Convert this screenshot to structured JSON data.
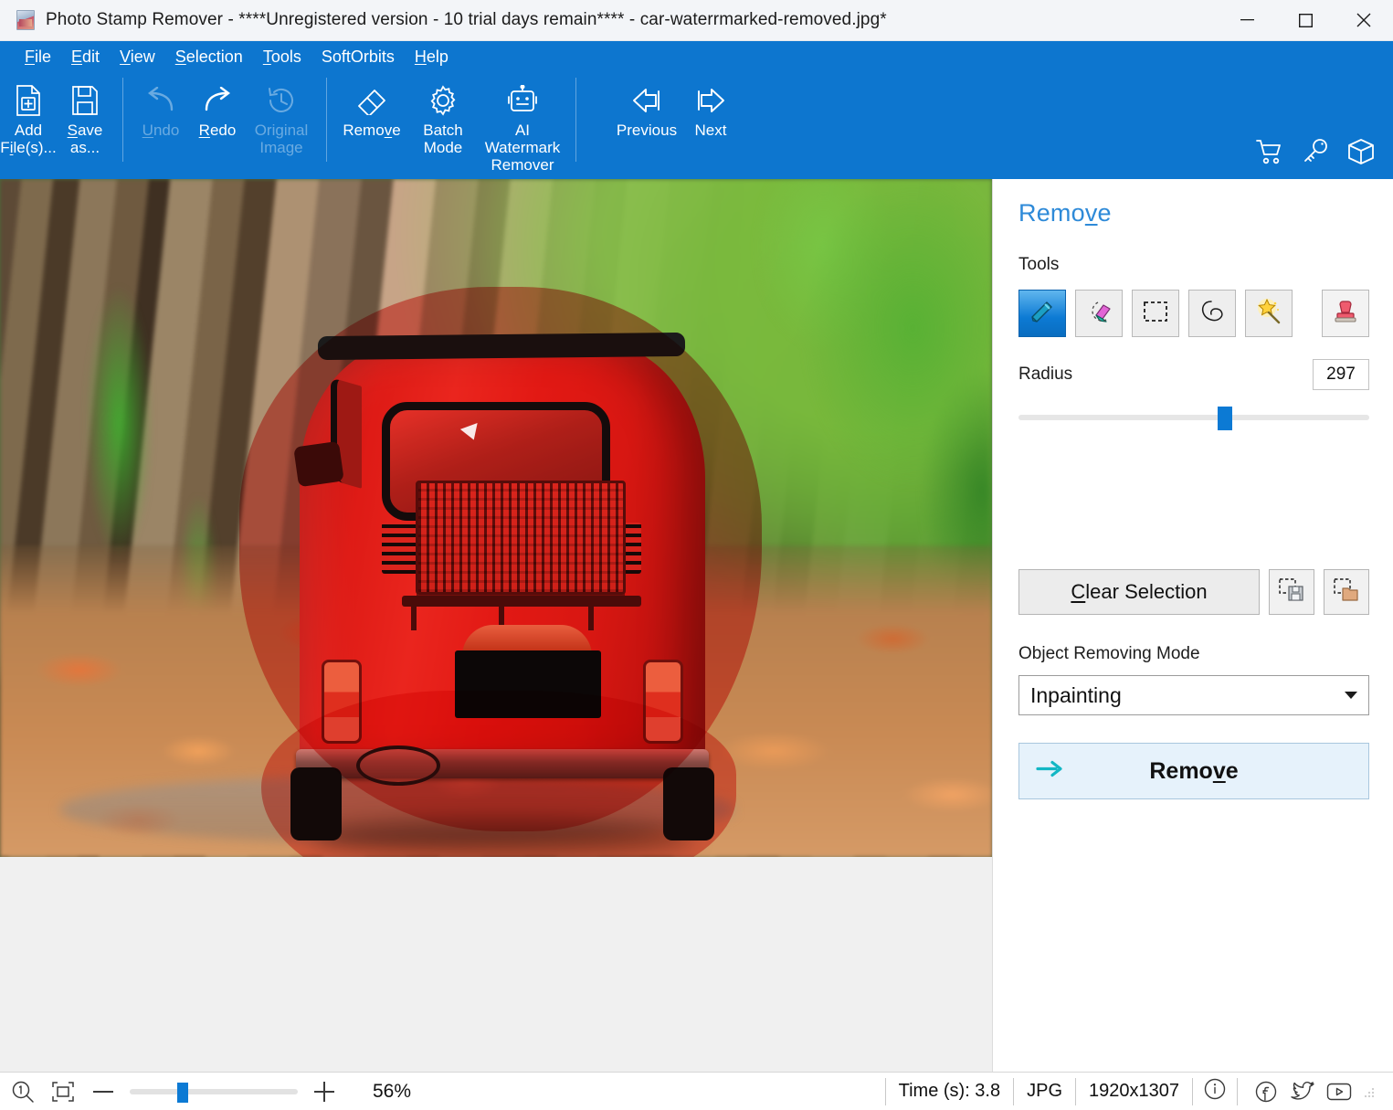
{
  "window": {
    "title": "Photo Stamp Remover - ****Unregistered version - 10 trial days remain**** - car-waterrmarked-removed.jpg*",
    "app_icon": "app-icon",
    "minimize": "minimize-icon",
    "maximize": "maximize-icon",
    "close": "close-icon"
  },
  "menu": {
    "items": [
      {
        "label": "File",
        "accel": "F"
      },
      {
        "label": "Edit",
        "accel": "E"
      },
      {
        "label": "View",
        "accel": "V"
      },
      {
        "label": "Selection",
        "accel": "S"
      },
      {
        "label": "Tools",
        "accel": "T"
      },
      {
        "label": "SoftOrbits",
        "accel": ""
      },
      {
        "label": "Help",
        "accel": "H"
      }
    ]
  },
  "ribbon": {
    "buttons": [
      {
        "name": "add-files",
        "line1": "Add",
        "line2": "File(s)...",
        "icon": "add-file-icon",
        "disabled": false
      },
      {
        "name": "save-as",
        "line1": "Save",
        "line2": "as...",
        "icon": "save-icon",
        "disabled": false
      },
      {
        "name": "undo",
        "line1": "Undo",
        "line2": "",
        "icon": "undo-icon",
        "disabled": true
      },
      {
        "name": "redo",
        "line1": "Redo",
        "line2": "",
        "icon": "redo-icon",
        "disabled": false
      },
      {
        "name": "original",
        "line1": "Original",
        "line2": "Image",
        "icon": "history-icon",
        "disabled": true
      },
      {
        "name": "remove",
        "line1": "Remove",
        "line2": "",
        "icon": "eraser-icon",
        "disabled": false
      },
      {
        "name": "batch-mode",
        "line1": "Batch",
        "line2": "Mode",
        "icon": "gear-icon",
        "disabled": false
      },
      {
        "name": "ai-watermark",
        "line1": "AI Watermark",
        "line2": "Remover",
        "icon": "robot-icon",
        "disabled": false
      },
      {
        "name": "previous",
        "line1": "Previous",
        "line2": "",
        "icon": "arrow-left-icon",
        "disabled": false
      },
      {
        "name": "next",
        "line1": "Next",
        "line2": "",
        "icon": "arrow-right-icon",
        "disabled": false
      }
    ],
    "right_icons": [
      {
        "name": "cart-icon",
        "title": "Buy"
      },
      {
        "name": "key-icon",
        "title": "Register"
      },
      {
        "name": "box-icon",
        "title": "Products"
      }
    ]
  },
  "panel": {
    "title": "Remove",
    "title_accel": "v",
    "tools_label": "Tools",
    "tools": [
      {
        "name": "brush-tool",
        "icon": "pencil-icon",
        "selected": true
      },
      {
        "name": "eraser-tool",
        "icon": "eraser-icon",
        "selected": false
      },
      {
        "name": "rectangle-tool",
        "icon": "marquee-icon",
        "selected": false
      },
      {
        "name": "lasso-tool",
        "icon": "lasso-icon",
        "selected": false
      },
      {
        "name": "magic-wand-tool",
        "icon": "magic-wand-icon",
        "selected": false
      },
      {
        "name": "stamp-tool",
        "icon": "stamp-icon",
        "selected": false
      }
    ],
    "radius_label": "Radius",
    "radius_value": "297",
    "clear_selection": "Clear Selection",
    "clear_selection_accel": "C",
    "save_selection_icon": "save-selection-icon",
    "load_selection_icon": "load-selection-icon",
    "mode_label": "Object Removing Mode",
    "mode_value": "Inpainting",
    "remove_button": "Remove",
    "remove_button_accel": "v",
    "accent_color": "#0c7ad4",
    "title_color": "#2e8ad8"
  },
  "statusbar": {
    "zoom_100_icon": "zoom-100-icon",
    "fit_icon": "fit-to-screen-icon",
    "minus": "−",
    "plus": "+",
    "zoom_percent": "56%",
    "time": "Time (s): 3.8",
    "format": "JPG",
    "dimensions": "1920x1307",
    "info_icon": "info-icon",
    "facebook_icon": "facebook-icon",
    "twitter_icon": "twitter-icon",
    "youtube_icon": "youtube-icon"
  },
  "canvas": {
    "description": "red-vintage-car-in-autumn-forest",
    "selection_overlay_color": "#ec241c"
  }
}
